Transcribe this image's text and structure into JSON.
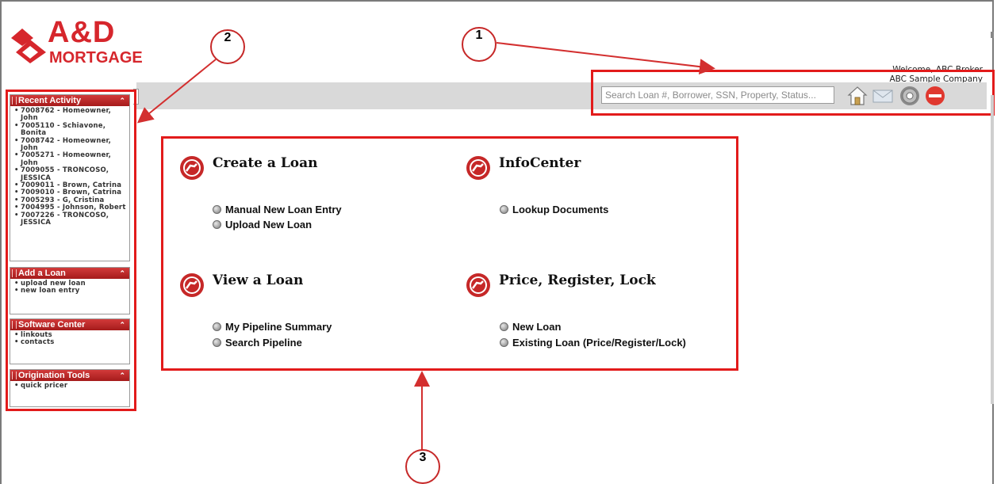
{
  "brand": {
    "line1": "A&D",
    "line2": "MORTGAGE",
    "color": "#d6262c"
  },
  "welcome": {
    "line1": "Welcome, ABC Broker",
    "line2": "_ABC Sample Company"
  },
  "search": {
    "placeholder": "Search Loan #, Borrower, SSN, Property, Status..."
  },
  "toolbar": {
    "icons": [
      "home-icon",
      "mail-icon",
      "gear-icon",
      "logout-icon"
    ]
  },
  "sidebar": {
    "recent": {
      "title": "Recent Activity",
      "items": [
        "7008762 - Homeowner, John",
        "7005110 - Schiavone, Bonita",
        "7008742 - Homeowner, John",
        "7005271 - Homeowner, John",
        "7009055 - TRONCOSO, JESSICA",
        "7009011 - Brown, Catrina",
        "7009010 - Brown, Catrina",
        "7005293 - G, Cristina",
        "7004995 - Johnson, Robert",
        "7007226 - TRONCOSO, JESSICA"
      ]
    },
    "add_loan": {
      "title": "Add a Loan",
      "items": [
        "upload new loan",
        "new loan entry"
      ]
    },
    "software": {
      "title": "Software Center",
      "items": [
        "linkouts",
        "contacts"
      ]
    },
    "origination": {
      "title": "Origination Tools",
      "items": [
        "quick pricer"
      ]
    }
  },
  "main": {
    "create": {
      "title": "Create a Loan",
      "links": [
        "Manual New Loan Entry",
        "Upload New Loan"
      ]
    },
    "infocenter": {
      "title": "InfoCenter",
      "links": [
        "Lookup Documents"
      ]
    },
    "view": {
      "title": "View a Loan",
      "links": [
        "My Pipeline Summary",
        "Search Pipeline"
      ]
    },
    "price": {
      "title": "Price, Register, Lock",
      "links": [
        "New Loan",
        "Existing Loan (Price/Register/Lock)"
      ]
    }
  },
  "callouts": [
    "1",
    "2",
    "3"
  ],
  "colors": {
    "accent": "#e21b1b",
    "panel_header": "#b82323",
    "topbar": "#d9d9d9"
  }
}
